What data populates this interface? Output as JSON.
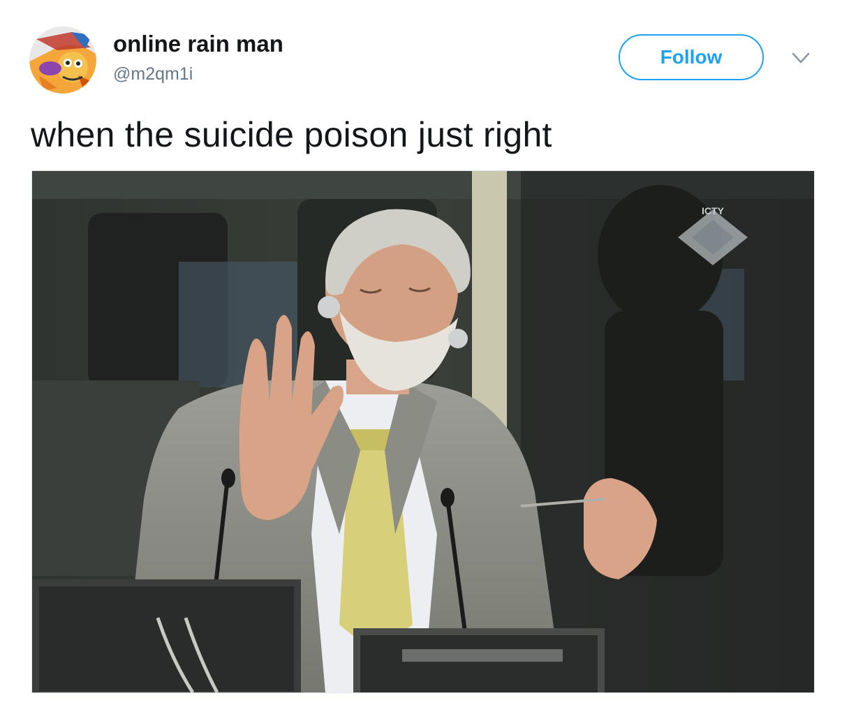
{
  "tweet": {
    "author": {
      "display_name": "online rain man",
      "handle": "@m2qm1i",
      "avatar_icon": "cartoon-avatar-icon"
    },
    "follow_label": "Follow",
    "menu_icon": "chevron-down-icon",
    "text": "when the suicide poison just right",
    "media": {
      "type": "photo",
      "watermark_text": "ICTY"
    }
  },
  "colors": {
    "accent": "#1da1f2",
    "text_primary": "#14171a",
    "text_secondary": "#657786",
    "border": "#e1e8ed"
  }
}
